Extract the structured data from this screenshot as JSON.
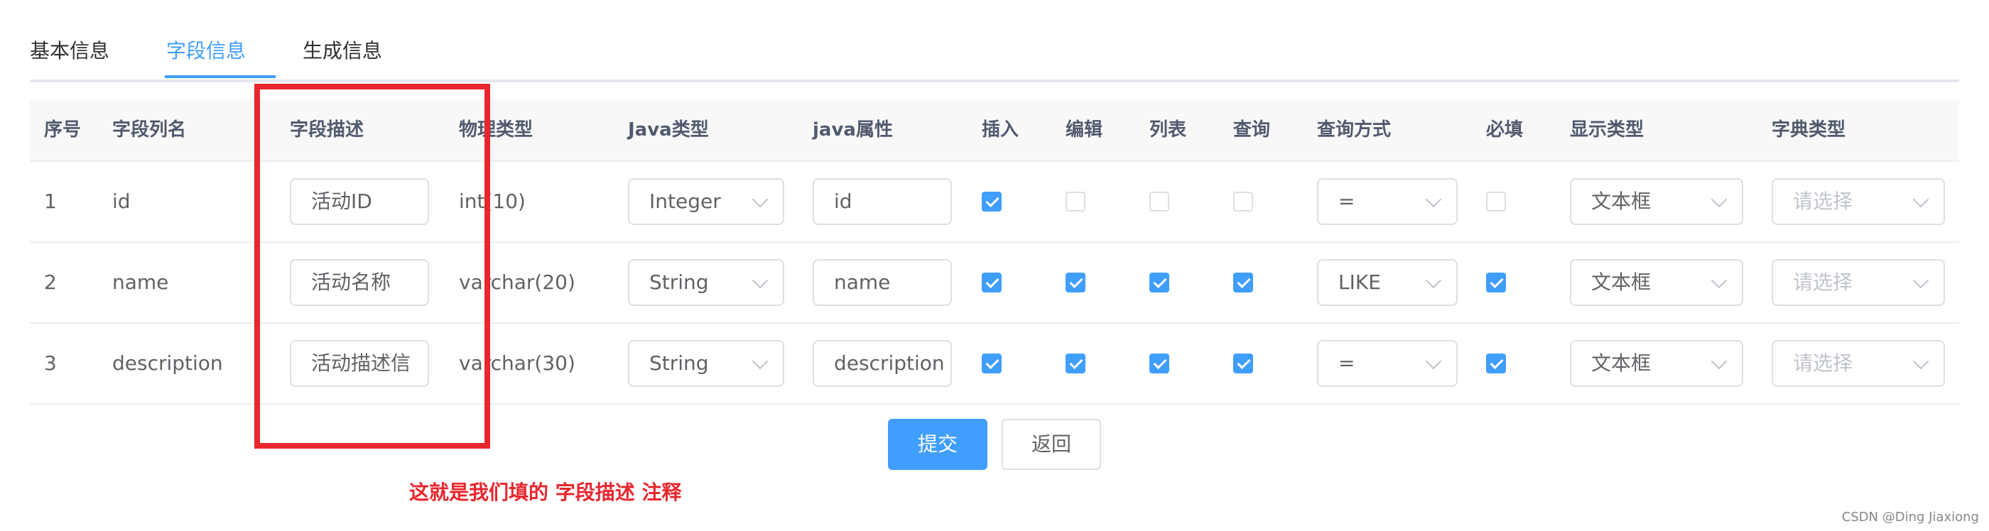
{
  "tabs": [
    {
      "label": "基本信息",
      "active": false
    },
    {
      "label": "字段信息",
      "active": true
    },
    {
      "label": "生成信息",
      "active": false
    }
  ],
  "columns": [
    "序号",
    "字段列名",
    "字段描述",
    "物理类型",
    "Java类型",
    "java属性",
    "插入",
    "编辑",
    "列表",
    "查询",
    "查询方式",
    "必填",
    "显示类型",
    "字典类型"
  ],
  "rows": [
    {
      "index": "1",
      "name": "id",
      "desc": "活动ID",
      "physical": "int(10)",
      "javaType": "Integer",
      "javaField": "id",
      "insert": true,
      "edit": false,
      "list": false,
      "query": false,
      "queryType": "=",
      "required": false,
      "htmlType": "文本框",
      "dictPlaceholder": "请选择"
    },
    {
      "index": "2",
      "name": "name",
      "desc": "活动名称",
      "physical": "varchar(20)",
      "javaType": "String",
      "javaField": "name",
      "insert": true,
      "edit": true,
      "list": true,
      "query": true,
      "queryType": "LIKE",
      "required": true,
      "htmlType": "文本框",
      "dictPlaceholder": "请选择"
    },
    {
      "index": "3",
      "name": "description",
      "desc": "活动描述信",
      "physical": "varchar(30)",
      "javaType": "String",
      "javaField": "description",
      "insert": true,
      "edit": true,
      "list": true,
      "query": true,
      "queryType": "=",
      "required": true,
      "htmlType": "文本框",
      "dictPlaceholder": "请选择"
    }
  ],
  "buttons": {
    "submit": "提交",
    "back": "返回"
  },
  "annotation": "这就是我们填的 字段描述 注释",
  "watermark": "CSDN @Ding Jiaxiong",
  "colors": {
    "accent": "#409eff",
    "annotation": "#e8262d",
    "border": "#dcdfe6"
  }
}
